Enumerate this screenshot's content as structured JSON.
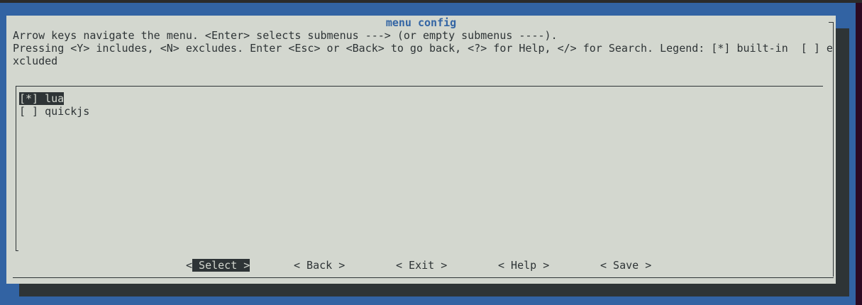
{
  "dialog": {
    "title": "menu config",
    "help_lines": [
      "Arrow keys navigate the menu. <Enter> selects submenus ---> (or empty submenus ----).",
      "Pressing <Y> includes, <N> excludes. Enter <Esc> or <Back> to go back, <?> for Help, </> for Search. Legend: [*] built-in  [ ] e",
      "xcluded"
    ]
  },
  "menu": {
    "items": [
      {
        "mark": "[*]",
        "label": "lua",
        "selected": true
      },
      {
        "mark": "[ ]",
        "label": "quickjs",
        "selected": false
      }
    ]
  },
  "buttons": {
    "select_left": "<",
    "select": " Select >",
    "back": "< Back >",
    "exit": "< Exit >",
    "help": "< Help >",
    "save": "< Save >"
  }
}
